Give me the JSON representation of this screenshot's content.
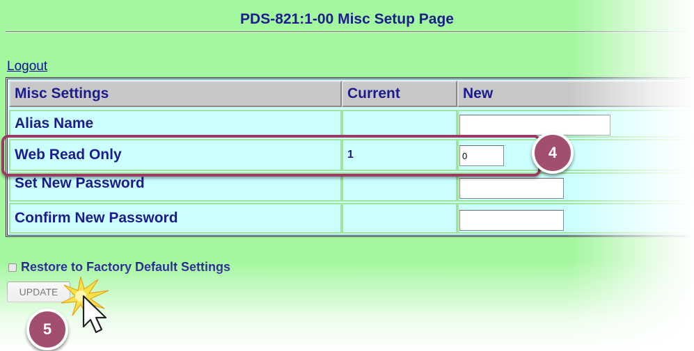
{
  "page": {
    "title": "PDS-821:1-00 Misc Setup Page",
    "logout_label": "Logout"
  },
  "table": {
    "headers": [
      "Misc Settings",
      "Current",
      "New"
    ],
    "rows": [
      {
        "label": "Alias Name",
        "current": "",
        "new": ""
      },
      {
        "label": "Web Read Only",
        "current": "1",
        "new": "0"
      },
      {
        "label": "Set New Password",
        "current": "",
        "new": ""
      },
      {
        "label": "Confirm New Password",
        "current": "",
        "new": ""
      }
    ]
  },
  "restore": {
    "label": "Restore to Factory Default Settings",
    "checked": false
  },
  "update_button": {
    "label": "UPDATE"
  },
  "annotations": {
    "step_a": "4",
    "step_b": "5"
  },
  "colors": {
    "page_bg": "#a3f79e",
    "cell_bg": "#ccffff",
    "text": "#1c1c8c",
    "highlight": "#9c3a63",
    "badge": "#a24e71"
  }
}
